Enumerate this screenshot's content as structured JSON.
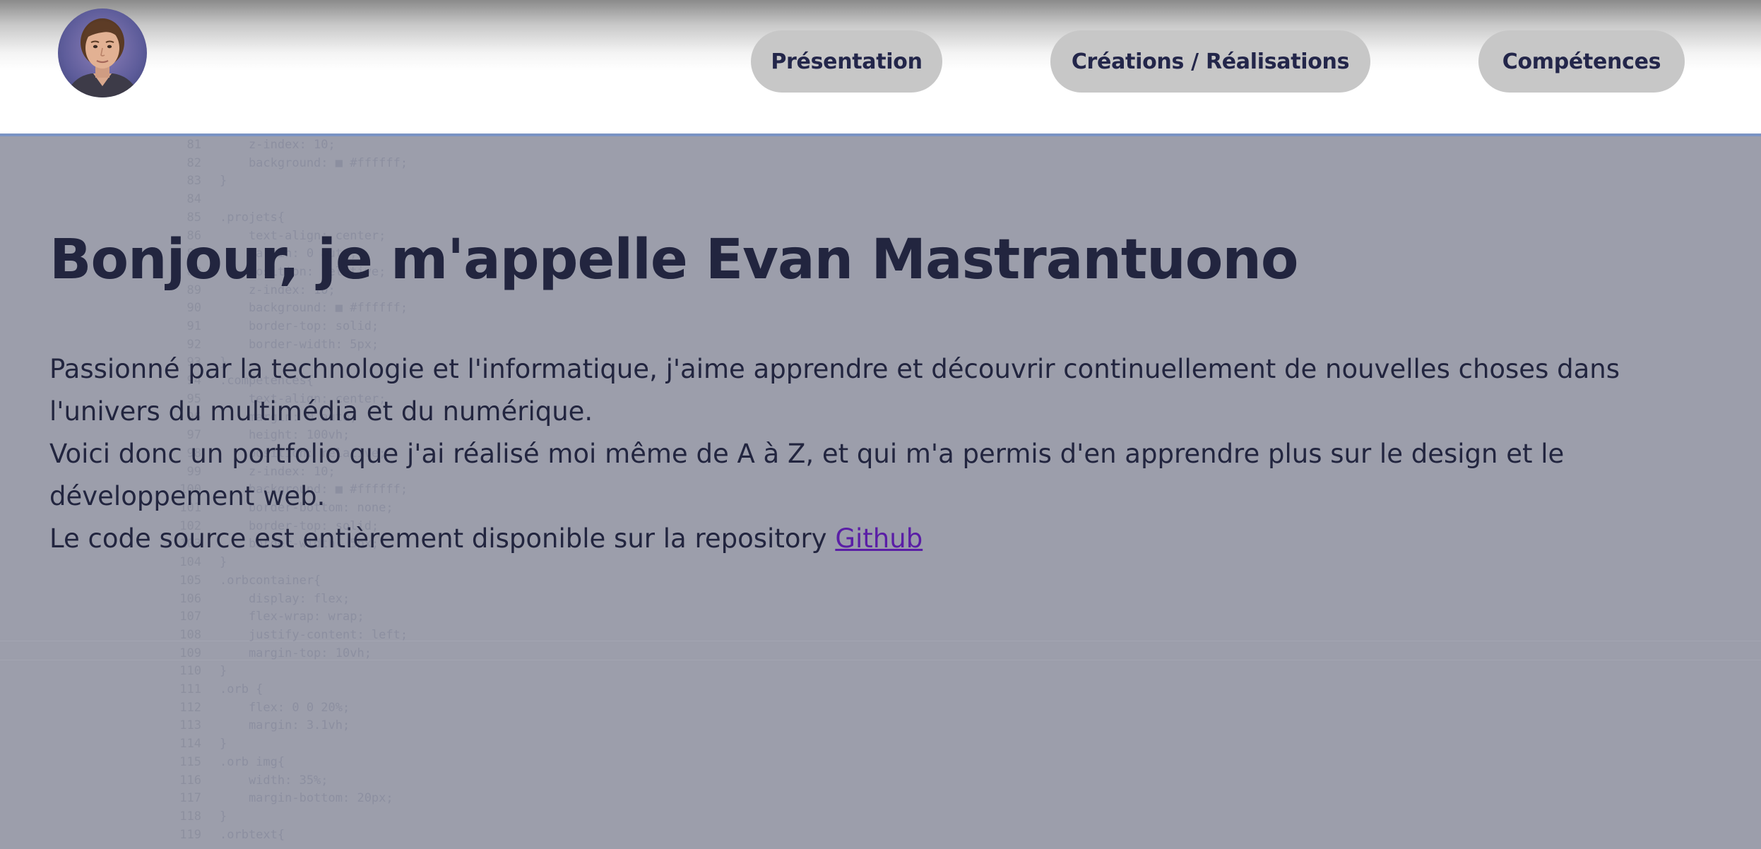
{
  "header": {
    "nav": [
      {
        "label": "Présentation"
      },
      {
        "label": "Créations / Réalisations"
      },
      {
        "label": "Compétences"
      }
    ]
  },
  "main": {
    "title": "Bonjour, je m'appelle Evan Mastrantuono",
    "paragraph_1": "Passionné par la technologie et l'informatique, j'aime apprendre et découvrir continuellement de nouvelles choses dans l'univers du multimédia et du numérique.",
    "paragraph_2": "Voici donc un portfolio que j'ai réalisé moi même de A à Z, et qui m'a permis d'en apprendre plus sur le design et le développement web.",
    "paragraph_3_prefix": "Le code source est entièrement disponible sur la repository ",
    "github_link": "Github"
  },
  "background_code": [
    {
      "n": "81",
      "t": "    z-index: 10;"
    },
    {
      "n": "82",
      "t": "    background: ■ #ffffff;"
    },
    {
      "n": "83",
      "t": "}"
    },
    {
      "n": "84",
      "t": ""
    },
    {
      "n": "85",
      "t": ".projets{"
    },
    {
      "n": "86",
      "t": "    text-align: center;"
    },
    {
      "n": "87",
      "t": "    margin: 0 auto;"
    },
    {
      "n": "88",
      "t": "    position: relative;"
    },
    {
      "n": "89",
      "t": "    z-index: 10;"
    },
    {
      "n": "90",
      "t": "    background: ■ #ffffff;"
    },
    {
      "n": "91",
      "t": "    border-top: solid;"
    },
    {
      "n": "92",
      "t": "    border-width: 5px;"
    },
    {
      "n": "93",
      "t": "}"
    },
    {
      "n": "94",
      "t": ".competences{"
    },
    {
      "n": "95",
      "t": "    text-align: center;"
    },
    {
      "n": "96",
      "t": "    margin: 0 auto;"
    },
    {
      "n": "97",
      "t": "    height: 100vh;"
    },
    {
      "n": "98",
      "t": "    position: relative;"
    },
    {
      "n": "99",
      "t": "    z-index: 10;"
    },
    {
      "n": "100",
      "t": "    background: ■ #ffffff;"
    },
    {
      "n": "101",
      "t": "    border-bottom: none;"
    },
    {
      "n": "102",
      "t": "    border-top: solid;"
    },
    {
      "n": "103",
      "t": "    border-width: 5px;"
    },
    {
      "n": "104",
      "t": "}"
    },
    {
      "n": "105",
      "t": ".orbcontainer{"
    },
    {
      "n": "106",
      "t": "    display: flex;"
    },
    {
      "n": "107",
      "t": "    flex-wrap: wrap;"
    },
    {
      "n": "108",
      "t": "    justify-content: left;"
    },
    {
      "n": "109",
      "t": "    margin-top: 10vh;"
    },
    {
      "n": "110",
      "t": "}"
    },
    {
      "n": "111",
      "t": ".orb {"
    },
    {
      "n": "112",
      "t": "    flex: 0 0 20%;"
    },
    {
      "n": "113",
      "t": "    margin: 3.1vh;"
    },
    {
      "n": "114",
      "t": "}"
    },
    {
      "n": "115",
      "t": ".orb img{"
    },
    {
      "n": "116",
      "t": "    width: 35%;"
    },
    {
      "n": "117",
      "t": "    margin-bottom: 20px;"
    },
    {
      "n": "118",
      "t": "}"
    },
    {
      "n": "119",
      "t": ".orbtext{"
    }
  ]
}
